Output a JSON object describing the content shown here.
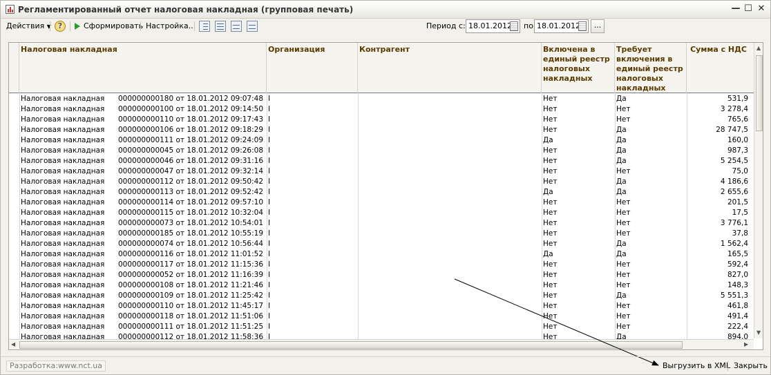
{
  "window": {
    "title": "Регламентированный отчет налоговая накладная (групповая печать)",
    "minimize": "—",
    "maximize": "☐",
    "close": "✕"
  },
  "toolbar": {
    "actions_label": "Действия",
    "help_label": "?",
    "generate_label": "Сформировать",
    "settings_label": "Настройка...",
    "period_from_label": "Период с:",
    "period_from_value": "18.01.2012",
    "period_to_label": "по",
    "period_to_value": "18.01.2012",
    "dots_label": "..."
  },
  "grid": {
    "columns": [
      "Налоговая накладная",
      "Организация",
      "Контрагент",
      "Включена в единый реестр налоговых накладных",
      "Требует включения в единый реестр налоговых накладных",
      "Сумма с НДС"
    ],
    "rows": [
      {
        "doc": "Налоговая накладная",
        "num": "000000000180 от 18.01.2012 09:07:48",
        "org": "I",
        "incl": "Нет",
        "req": "Да",
        "sum": "531,9"
      },
      {
        "doc": "Налоговая накладная",
        "num": "000000000100 от 18.01.2012 09:14:50",
        "org": "I",
        "incl": "Нет",
        "req": "Нет",
        "sum": "3 278,4"
      },
      {
        "doc": "Налоговая накладная",
        "num": "000000000110 от 18.01.2012 09:17:43",
        "org": "I",
        "incl": "Нет",
        "req": "Нет",
        "sum": "765,6"
      },
      {
        "doc": "Налоговая накладная",
        "num": "000000000106 от 18.01.2012 09:18:29",
        "org": "I",
        "incl": "Нет",
        "req": "Да",
        "sum": "28 747,5"
      },
      {
        "doc": "Налоговая накладная",
        "num": "000000000111 от 18.01.2012 09:24:09",
        "org": "I",
        "incl": "Да",
        "req": "Да",
        "sum": "160,0"
      },
      {
        "doc": "Налоговая накладная",
        "num": "000000000045 от 18.01.2012 09:26:08",
        "org": "I",
        "incl": "Нет",
        "req": "Да",
        "sum": "987,3"
      },
      {
        "doc": "Налоговая накладная",
        "num": "000000000046 от 18.01.2012 09:31:16",
        "org": "I",
        "incl": "Нет",
        "req": "Да",
        "sum": "5 254,5"
      },
      {
        "doc": "Налоговая накладная",
        "num": "000000000047 от 18.01.2012 09:32:14",
        "org": "I",
        "incl": "Нет",
        "req": "Нет",
        "sum": "75,0"
      },
      {
        "doc": "Налоговая накладная",
        "num": "000000000112 от 18.01.2012 09:50:42",
        "org": "I",
        "incl": "Нет",
        "req": "Да",
        "sum": "4 186,6"
      },
      {
        "doc": "Налоговая накладная",
        "num": "000000000113 от 18.01.2012 09:52:42",
        "org": "I",
        "incl": "Да",
        "req": "Да",
        "sum": "2 655,6"
      },
      {
        "doc": "Налоговая накладная",
        "num": "000000000114 от 18.01.2012 09:57:10",
        "org": "I",
        "incl": "Нет",
        "req": "Нет",
        "sum": "201,5"
      },
      {
        "doc": "Налоговая накладная",
        "num": "000000000115 от 18.01.2012 10:32:04",
        "org": "I",
        "incl": "Нет",
        "req": "Нет",
        "sum": "17,5"
      },
      {
        "doc": "Налоговая накладная",
        "num": "000000000073 от 18.01.2012 10:54:01",
        "org": "I",
        "incl": "Нет",
        "req": "Нет",
        "sum": "3 776,1"
      },
      {
        "doc": "Налоговая накладная",
        "num": "000000000185 от 18.01.2012 10:55:19",
        "org": "I",
        "incl": "Нет",
        "req": "Нет",
        "sum": "37,8"
      },
      {
        "doc": "Налоговая накладная",
        "num": "000000000074 от 18.01.2012 10:56:44",
        "org": "I",
        "incl": "Нет",
        "req": "Да",
        "sum": "1 562,4"
      },
      {
        "doc": "Налоговая накладная",
        "num": "000000000116 от 18.01.2012 11:01:52",
        "org": "I",
        "incl": "Да",
        "req": "Да",
        "sum": "165,5"
      },
      {
        "doc": "Налоговая накладная",
        "num": "000000000117 от 18.01.2012 11:15:36",
        "org": "I",
        "incl": "Нет",
        "req": "Нет",
        "sum": "592,4"
      },
      {
        "doc": "Налоговая накладная",
        "num": "000000000052 от 18.01.2012 11:16:39",
        "org": "I",
        "incl": "Нет",
        "req": "Нет",
        "sum": "827,0"
      },
      {
        "doc": "Налоговая накладная",
        "num": "000000000108 от 18.01.2012 11:21:46",
        "org": "I",
        "incl": "Нет",
        "req": "Нет",
        "sum": "148,3"
      },
      {
        "doc": "Налоговая накладная",
        "num": "000000000109 от 18.01.2012 11:25:42",
        "org": "I",
        "incl": "Нет",
        "req": "Да",
        "sum": "5 551,3"
      },
      {
        "doc": "Налоговая накладная",
        "num": "000000000110 от 18.01.2012 11:45:17",
        "org": "I",
        "incl": "Нет",
        "req": "Нет",
        "sum": "461,8"
      },
      {
        "doc": "Налоговая накладная",
        "num": "000000000118 от 18.01.2012 11:51:06",
        "org": "I",
        "incl": "Нет",
        "req": "Нет",
        "sum": "491,4"
      },
      {
        "doc": "Налоговая накладная",
        "num": "000000000111 от 18.01.2012 11:51:25",
        "org": "I",
        "incl": "Нет",
        "req": "Нет",
        "sum": "222,4"
      },
      {
        "doc": "Налоговая накладная",
        "num": "000000000112 от 18.01.2012 11:58:36",
        "org": "I",
        "incl": "Нет",
        "req": "Да",
        "sum": "894,0"
      }
    ]
  },
  "footer": {
    "developer_link": "Разработка:www.nct.ua",
    "export_xml_label": "Выгрузить в XML",
    "close_label": "Закрыть"
  }
}
